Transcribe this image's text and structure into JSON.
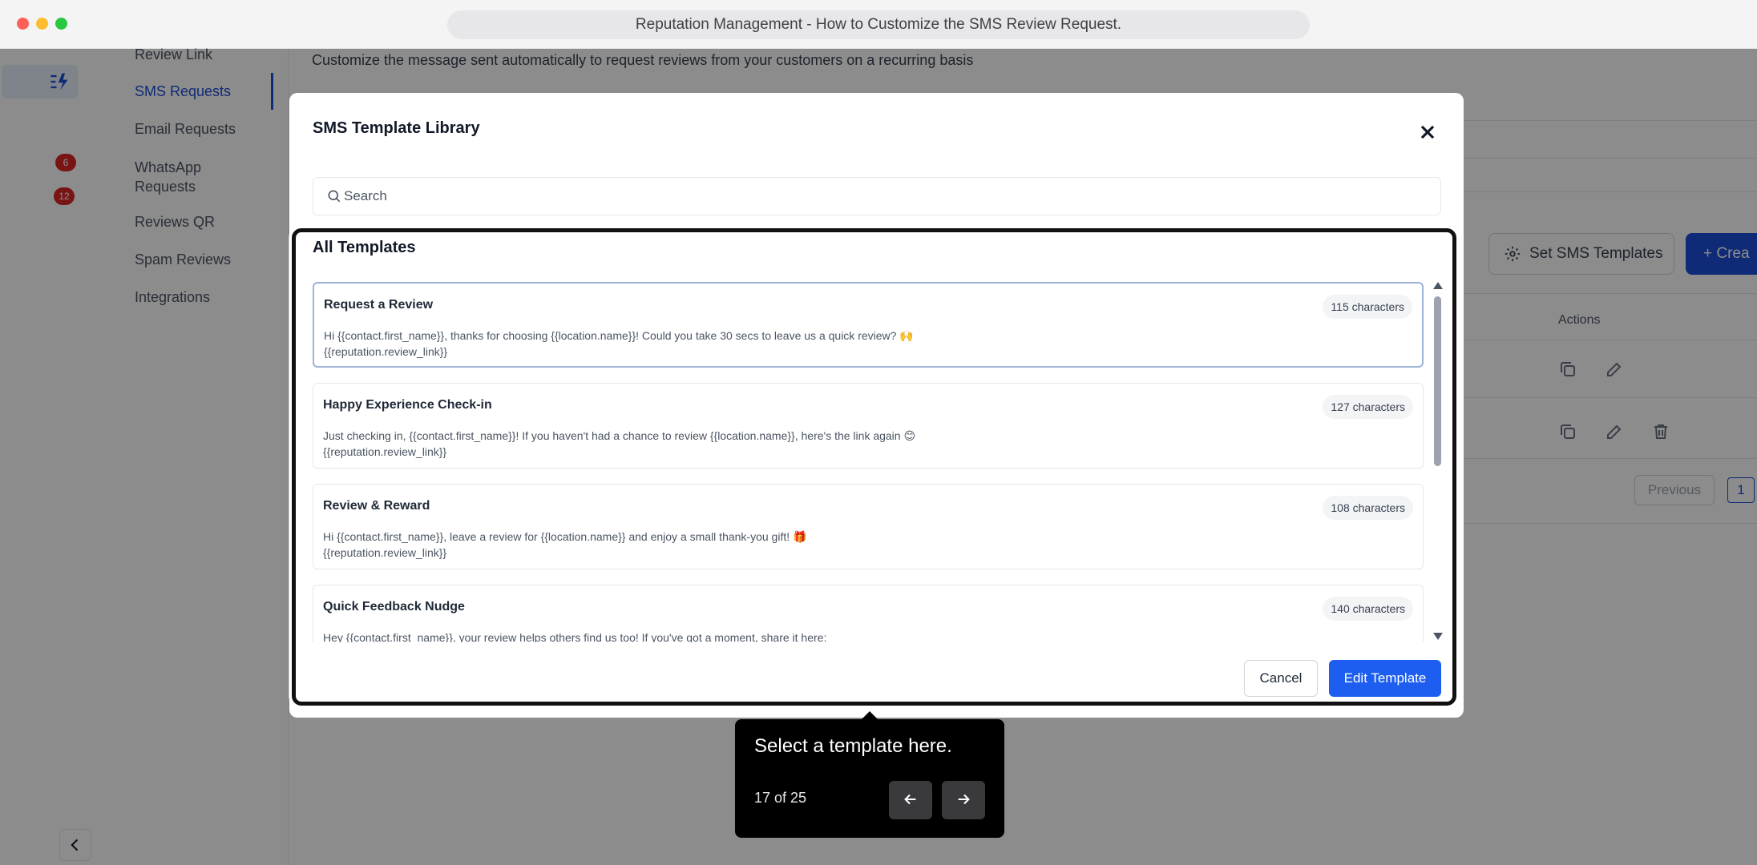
{
  "window": {
    "title": "Reputation Management - How to Customize the SMS Review Request."
  },
  "rail": {
    "badges": [
      "6",
      "12"
    ]
  },
  "subnav": {
    "items": [
      {
        "label": "Review Link"
      },
      {
        "label": "SMS Requests"
      },
      {
        "label": "Email Requests"
      },
      {
        "label": "WhatsApp Requests"
      },
      {
        "label": "Reviews QR"
      },
      {
        "label": "Spam Reviews"
      },
      {
        "label": "Integrations"
      }
    ]
  },
  "page": {
    "description": "Customize the message sent automatically to request reviews from your customers on a recurring basis",
    "set_templates_label": "Set SMS Templates",
    "create_label": "Crea",
    "actions_header": "Actions",
    "previous_label": "Previous",
    "current_page": "1"
  },
  "modal": {
    "title": "SMS Template Library",
    "search_placeholder": "Search",
    "section_title": "All Templates",
    "templates": [
      {
        "title": "Request a Review",
        "count": "115 characters",
        "line1": "Hi {{contact.first_name}}, thanks for choosing {{location.name}}! Could you take 30 secs to leave us a quick review? 🙌",
        "line2": "{{reputation.review_link}}"
      },
      {
        "title": "Happy Experience Check-in",
        "count": "127 characters",
        "line1": "Just checking in, {{contact.first_name}}! If you haven't had a chance to review {{location.name}}, here's the link again 😊",
        "line2": "{{reputation.review_link}}"
      },
      {
        "title": "Review & Reward",
        "count": "108 characters",
        "line1": "Hi {{contact.first_name}}, leave a review for {{location.name}} and enjoy a small thank-you gift! 🎁",
        "line2": "{{reputation.review_link}}"
      },
      {
        "title": "Quick Feedback Nudge",
        "count": "140 characters",
        "line1": "Hey {{contact.first_name}}, your review helps others find us too! If you've got a moment, share it here:",
        "line2": ""
      }
    ],
    "cancel_label": "Cancel",
    "edit_label": "Edit Template"
  },
  "tooltip": {
    "text": "Select a template here.",
    "step": "17 of 25"
  },
  "colors": {
    "accent": "#1d5ef0",
    "badge": "#dc2626",
    "tooltip_bg": "#000000"
  }
}
